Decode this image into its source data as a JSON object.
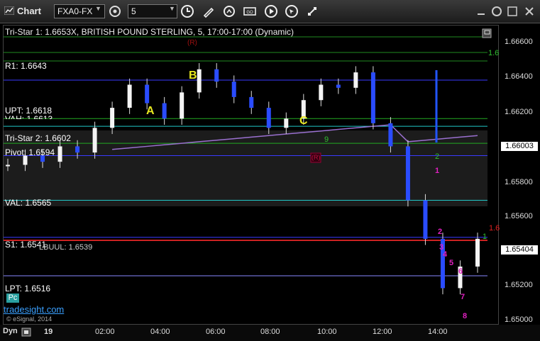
{
  "window": {
    "title": "Chart"
  },
  "toolbar": {
    "symbol": "FXA0-FX",
    "interval": "5",
    "icons": [
      "symbol-link-icon",
      "clock-icon",
      "draw-pen-icon",
      "refresh-icon",
      "sheet-icon",
      "play-icon",
      "cursor-icon",
      "settings-icon"
    ]
  },
  "chart": {
    "header": "Tri-Star 1: 1.6653 / FX, BRITISH POUND STERLING, 5, 17:00-17:00 (Dynamic)",
    "header_visible": "Tri-Star 1: 1.6653X, BRITISH POUND STERLING, 5, 17:00-17:00 (Dynamic)",
    "levels": [
      {
        "label": "R1: 1.6643",
        "value": 1.6643,
        "color": "#3a3aff"
      },
      {
        "label": "UPT: 1.6618",
        "value": 1.6618,
        "color": "#22aa22"
      },
      {
        "label": "VAH: 1.6613",
        "value": 1.6613,
        "color": "#20c8c8"
      },
      {
        "label": "Tri-Star 2: 1.6602",
        "value": 1.6602,
        "color": "#22aa22"
      },
      {
        "label": "Pivot: 1.6594",
        "value": 1.6594,
        "color": "#3a3aff"
      },
      {
        "label": "VAL: 1.6565",
        "value": 1.6565,
        "color": "#20c8c8"
      },
      {
        "label": "S1: 1.6541",
        "value": 1.6541,
        "color": "#3a3aff"
      },
      {
        "label": "LBUUL: 1.6539",
        "value": 1.6539,
        "color": "#cc2222"
      },
      {
        "label": "LPT: 1.6516",
        "value": 1.6516,
        "color": "#8888ff"
      }
    ],
    "side_labels": {
      "r_marker": "(R)",
      "r_marker2": "(R)",
      "right_green": "1.6",
      "right_red": "1.6"
    },
    "pattern_labels": [
      "A",
      "B",
      "C"
    ],
    "count_labels_magenta": [
      "1",
      "2",
      "3",
      "4",
      "5",
      "6",
      "7",
      "8"
    ],
    "count_labels_green": [
      "2",
      "1",
      "9"
    ],
    "price_axis": [
      "1.66600",
      "1.66400",
      "1.66200",
      "1.66003",
      "1.65800",
      "1.65600",
      "1.65404",
      "1.65200",
      "1.65000"
    ],
    "current_price": "1.65404",
    "last_marked": "1.66003",
    "time_axis": [
      "19",
      "02:00",
      "04:00",
      "06:00",
      "08:00",
      "10:00",
      "12:00",
      "14:00"
    ],
    "footer_brand": "tradesight.com",
    "copyright": "© eSignal, 2014",
    "pc_badge": "Pc",
    "dyn_label": "Dyn"
  },
  "chart_data": {
    "type": "candlestick",
    "title": "FX, BRITISH POUND STERLING, 5, 17:00-17:00 (Dynamic)",
    "ylim": [
      1.649,
      1.667
    ],
    "x": [
      "19",
      "02:00",
      "04:00",
      "06:00",
      "08:00",
      "10:00",
      "12:00",
      "14:00"
    ],
    "approx_close_path": [
      1.6588,
      1.6594,
      1.659,
      1.66,
      1.6596,
      1.6612,
      1.6625,
      1.664,
      1.6628,
      1.6618,
      1.6635,
      1.665,
      1.6642,
      1.6632,
      1.6625,
      1.6612,
      1.6618,
      1.663,
      1.664,
      1.6638,
      1.6648,
      1.6615,
      1.66,
      1.6565,
      1.654,
      1.6508,
      1.6522,
      1.654
    ]
  }
}
